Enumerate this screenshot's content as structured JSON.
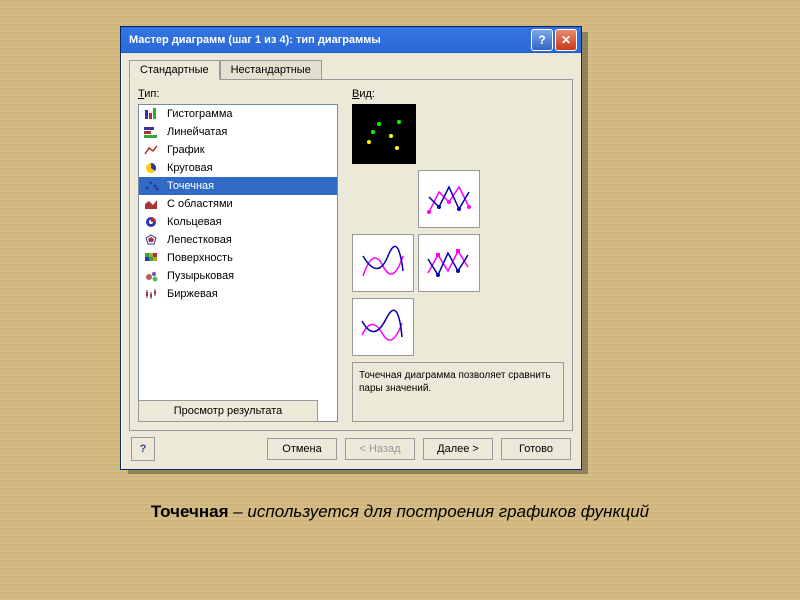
{
  "window": {
    "title": "Мастер диаграмм (шаг 1 из 4): тип диаграммы"
  },
  "tabs": {
    "standard": "Стандартные",
    "custom": "Нестандартные"
  },
  "labels": {
    "type": "Тип:",
    "view": "Вид:"
  },
  "types": [
    "Гистограмма",
    "Линейчатая",
    "График",
    "Круговая",
    "Точечная",
    "С областями",
    "Кольцевая",
    "Лепестковая",
    "Поверхность",
    "Пузырьковая",
    "Биржевая"
  ],
  "selectedIndex": 4,
  "description": "Точечная диаграмма позволяет сравнить пары значений.",
  "buttons": {
    "preview": "Просмотр результата",
    "cancel": "Отмена",
    "back": "< Назад",
    "next": "Далее >",
    "finish": "Готово"
  },
  "caption": {
    "bold": "Точечная",
    "rest": " – используется для построения графиков функций"
  }
}
